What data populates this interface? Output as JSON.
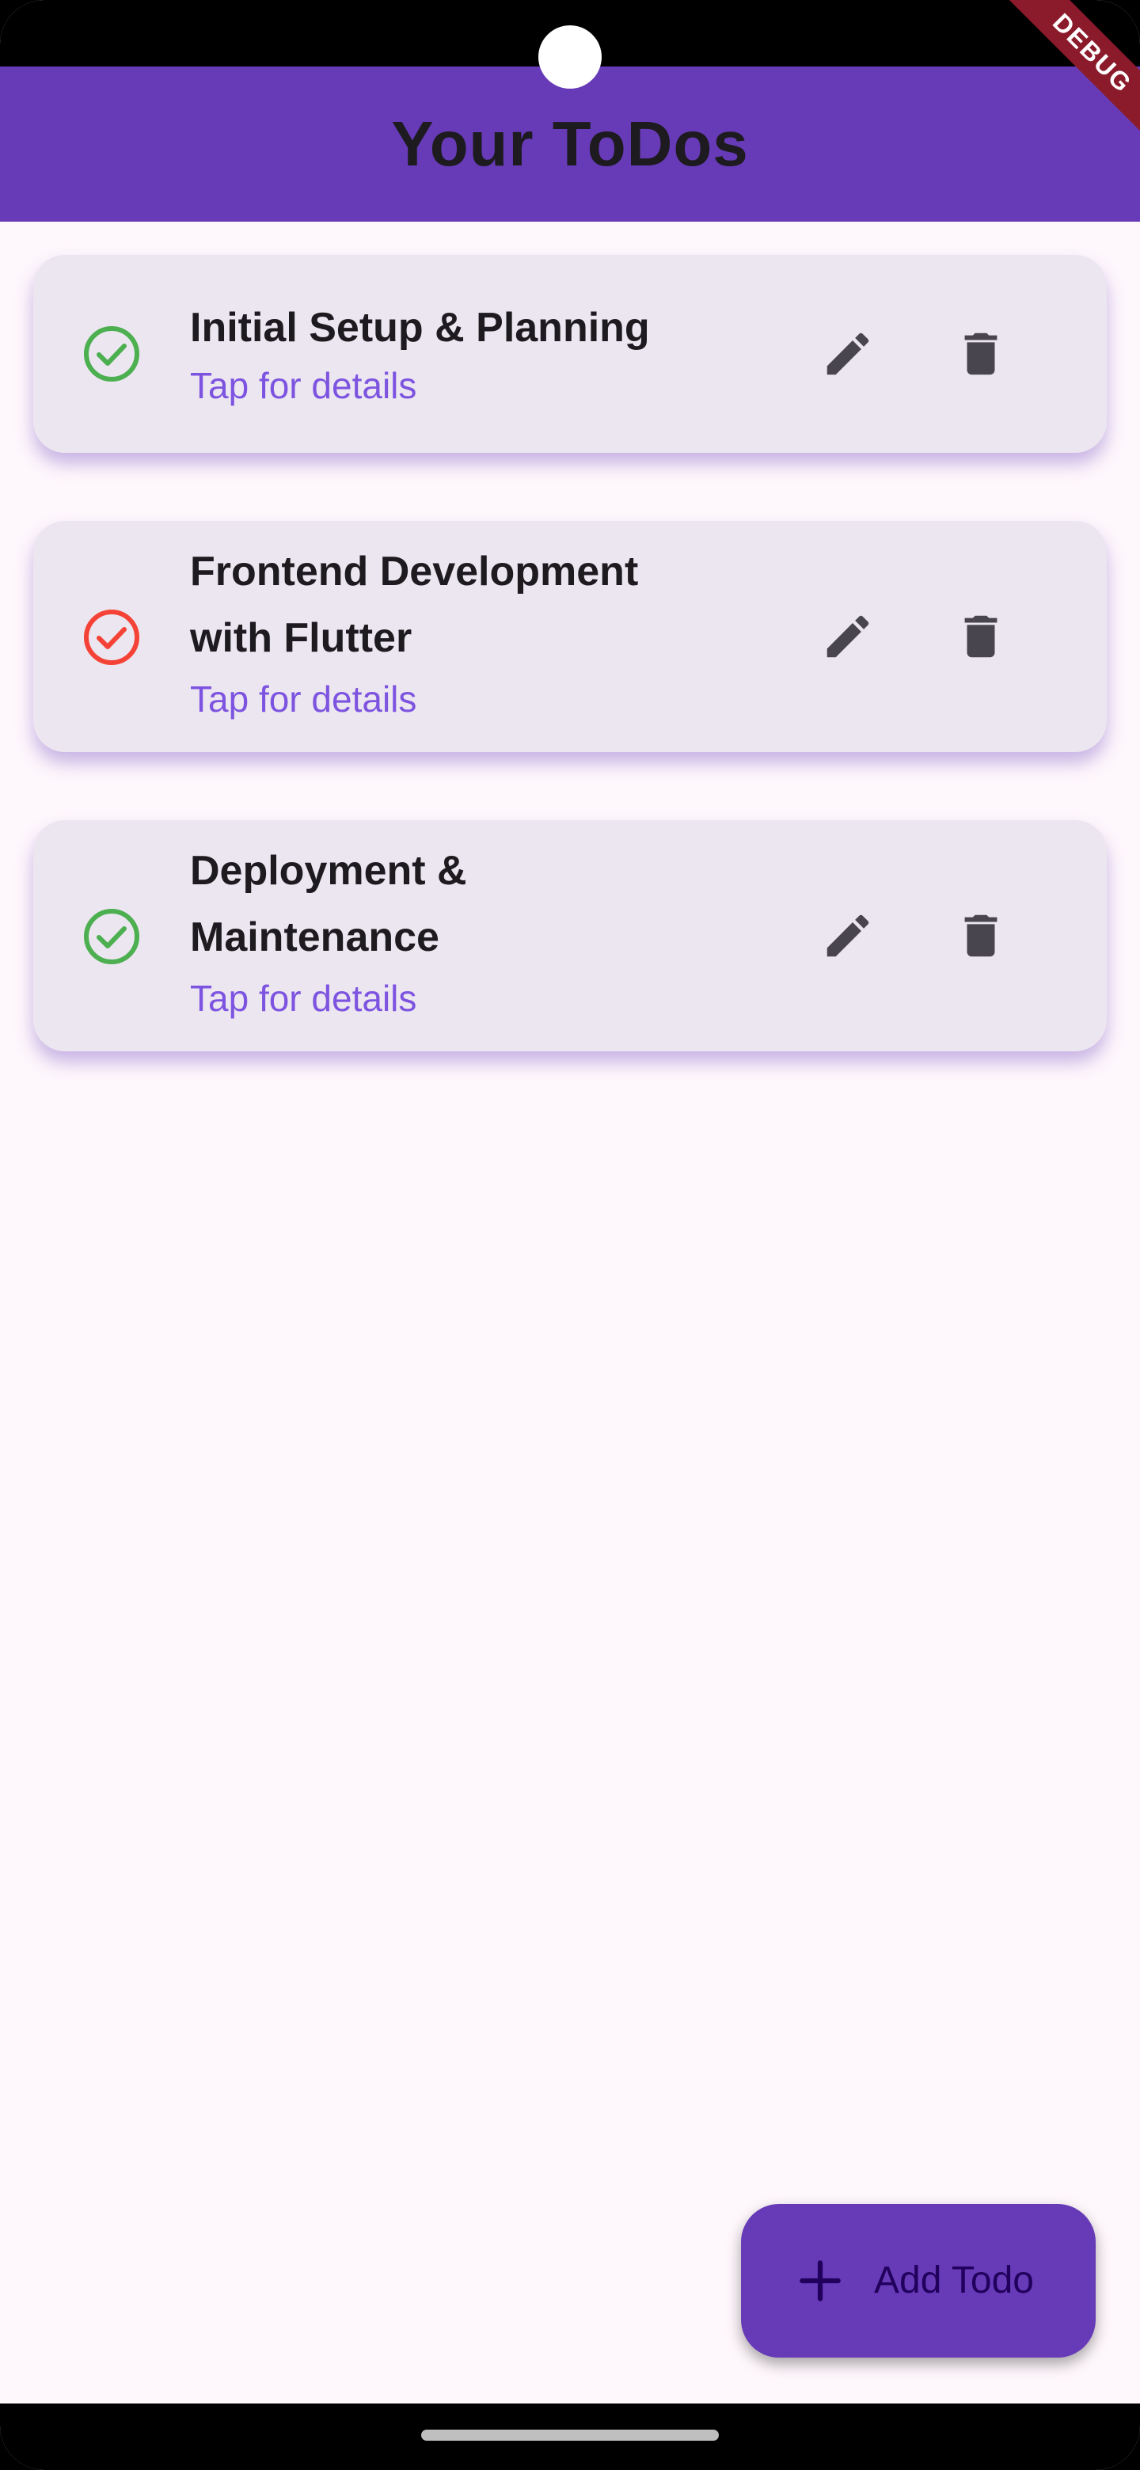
{
  "app_bar": {
    "title": "Your ToDos"
  },
  "debug_banner": "DEBUG",
  "todos": [
    {
      "title_lines": [
        "Initial Setup & Planning"
      ],
      "subtitle": "Tap for details",
      "status": "done",
      "status_color": "#4caf50"
    },
    {
      "title_lines": [
        "Frontend Development",
        "with Flutter"
      ],
      "subtitle": "Tap for details",
      "status": "not-done",
      "status_color": "#f44336"
    },
    {
      "title_lines": [
        "Deployment &",
        "Maintenance"
      ],
      "subtitle": "Tap for details",
      "status": "done",
      "status_color": "#4caf50"
    }
  ],
  "icons": {
    "edit": "pencil-icon",
    "delete": "trash-icon",
    "status": "check-circle-icon",
    "add": "plus-icon"
  },
  "fab": {
    "label": "Add Todo"
  },
  "colors": {
    "primary": "#673ab7",
    "card": "#ece6f0",
    "subtitle": "#7d54e0",
    "icon": "#49454f"
  }
}
